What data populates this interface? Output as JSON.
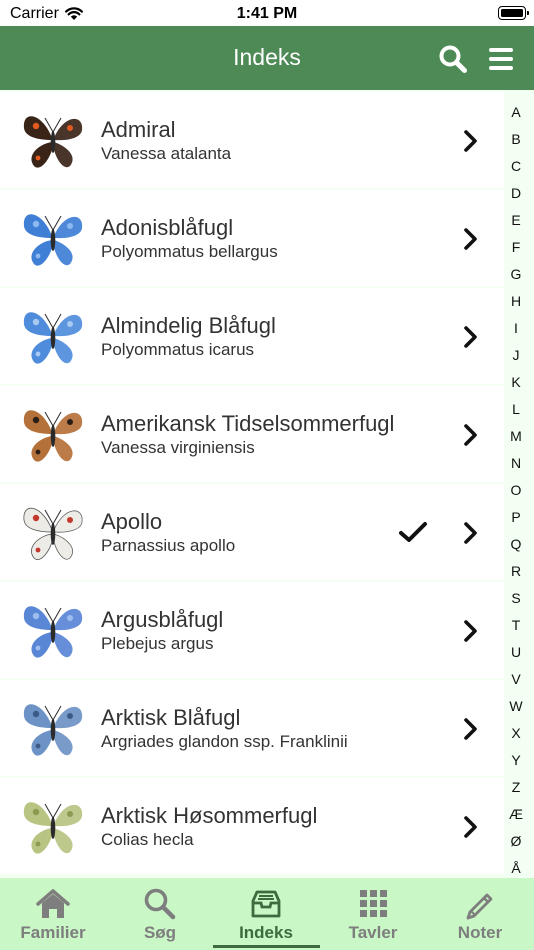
{
  "status_bar": {
    "carrier": "Carrier",
    "time": "1:41 PM"
  },
  "nav": {
    "title": "Indeks"
  },
  "entries": [
    {
      "name": "Admiral",
      "latin": "Vanessa atalanta",
      "checked": false,
      "wing": "#3a2418",
      "accent": "#e05a22"
    },
    {
      "name": "Adonisblåfugl",
      "latin": "Polyommatus bellargus",
      "checked": false,
      "wing": "#3f7fd6",
      "accent": "#8eb9f0"
    },
    {
      "name": "Almindelig Blåfugl",
      "latin": "Polyommatus icarus",
      "checked": false,
      "wing": "#4f8ddc",
      "accent": "#a7c9f2"
    },
    {
      "name": "Amerikansk Tidselsommerfugl",
      "latin": "Vanessa virginiensis",
      "checked": false,
      "wing": "#b5713a",
      "accent": "#2a1d16"
    },
    {
      "name": "Apollo",
      "latin": "Parnassius apollo",
      "checked": true,
      "wing": "#ecebe6",
      "accent": "#c23a2e"
    },
    {
      "name": "Argusblåfugl",
      "latin": "Plebejus argus",
      "checked": false,
      "wing": "#5a86d6",
      "accent": "#9fbef0"
    },
    {
      "name": "Arktisk Blåfugl",
      "latin": "Argriades glandon ssp. Franklinii",
      "checked": false,
      "wing": "#6c92c6",
      "accent": "#3d5a86"
    },
    {
      "name": "Arktisk Høsommerfugl",
      "latin": "Colias hecla",
      "checked": false,
      "wing": "#b7c482",
      "accent": "#8a9a50"
    }
  ],
  "alphabet": [
    "A",
    "B",
    "C",
    "D",
    "E",
    "F",
    "G",
    "H",
    "I",
    "J",
    "K",
    "L",
    "M",
    "N",
    "O",
    "P",
    "Q",
    "R",
    "S",
    "T",
    "U",
    "V",
    "W",
    "X",
    "Y",
    "Z",
    "Æ",
    "Ø",
    "Å"
  ],
  "tabs": [
    {
      "label": "Familier",
      "icon": "home-icon"
    },
    {
      "label": "Søg",
      "icon": "search-icon"
    },
    {
      "label": "Indeks",
      "icon": "inbox-tray-icon",
      "active": true
    },
    {
      "label": "Tavler",
      "icon": "grid-icon"
    },
    {
      "label": "Noter",
      "icon": "pencil-icon"
    }
  ],
  "colors": {
    "header": "#4e8a55",
    "tab_bar": "#c9f7c5",
    "list_bg": "#f3fff2",
    "active_tab": "#3c6b40",
    "inactive_tab": "#7e7e7e"
  }
}
